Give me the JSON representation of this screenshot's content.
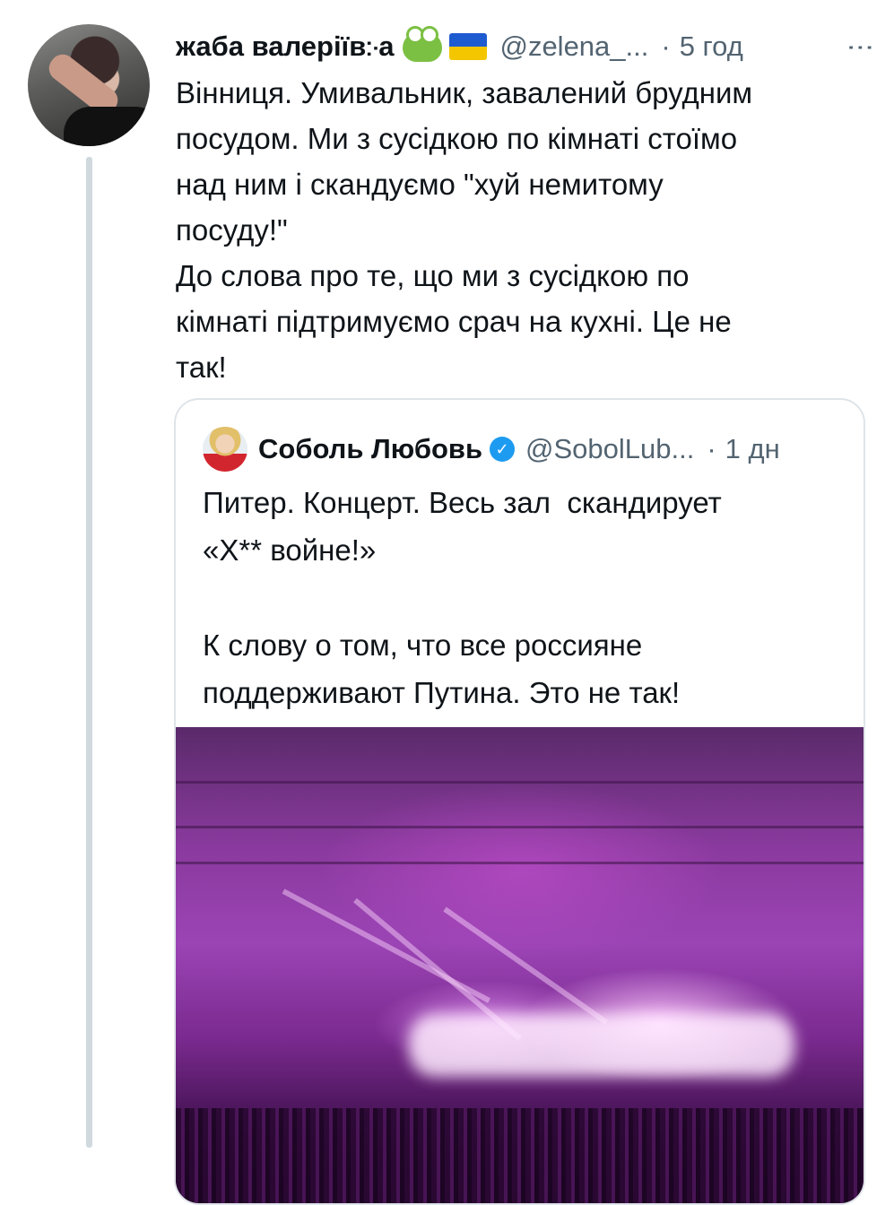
{
  "tweet": {
    "author_name": "жаба валеріїв჻а",
    "handle": "@zelena_...",
    "separator": "·",
    "time": "5 год",
    "more_icon": "⋮",
    "text": "Вінниця. Умивальник, завалений брудним\nпосудом. Ми з сусідкою по кімнаті стоїмо\nнад ним і скандуємо \"хуй немитому\nпосуду!\"\nДо слова про те, що ми з сусідкою по\nкімнаті підтримуємо срач на кухні. Це не\nтак!",
    "emojis": [
      "frog-icon",
      "ukraine-flag-icon"
    ]
  },
  "quoted_tweet": {
    "author_name": "Соболь Любовь",
    "verified_icon": "✓",
    "handle": "@SobolLub...",
    "separator": "·",
    "time": "1 дн",
    "text": "Питер. Концерт. Весь зал  скандирует\n«Х** войне!»\n\nК слову о том, что все россияне\nподдерживают Путина. Это не так!",
    "media": "concert-video-thumbnail"
  },
  "colors": {
    "text": "#0f1419",
    "secondary": "#536471",
    "verified": "#1d9bf0",
    "border": "#dfe4e8"
  }
}
